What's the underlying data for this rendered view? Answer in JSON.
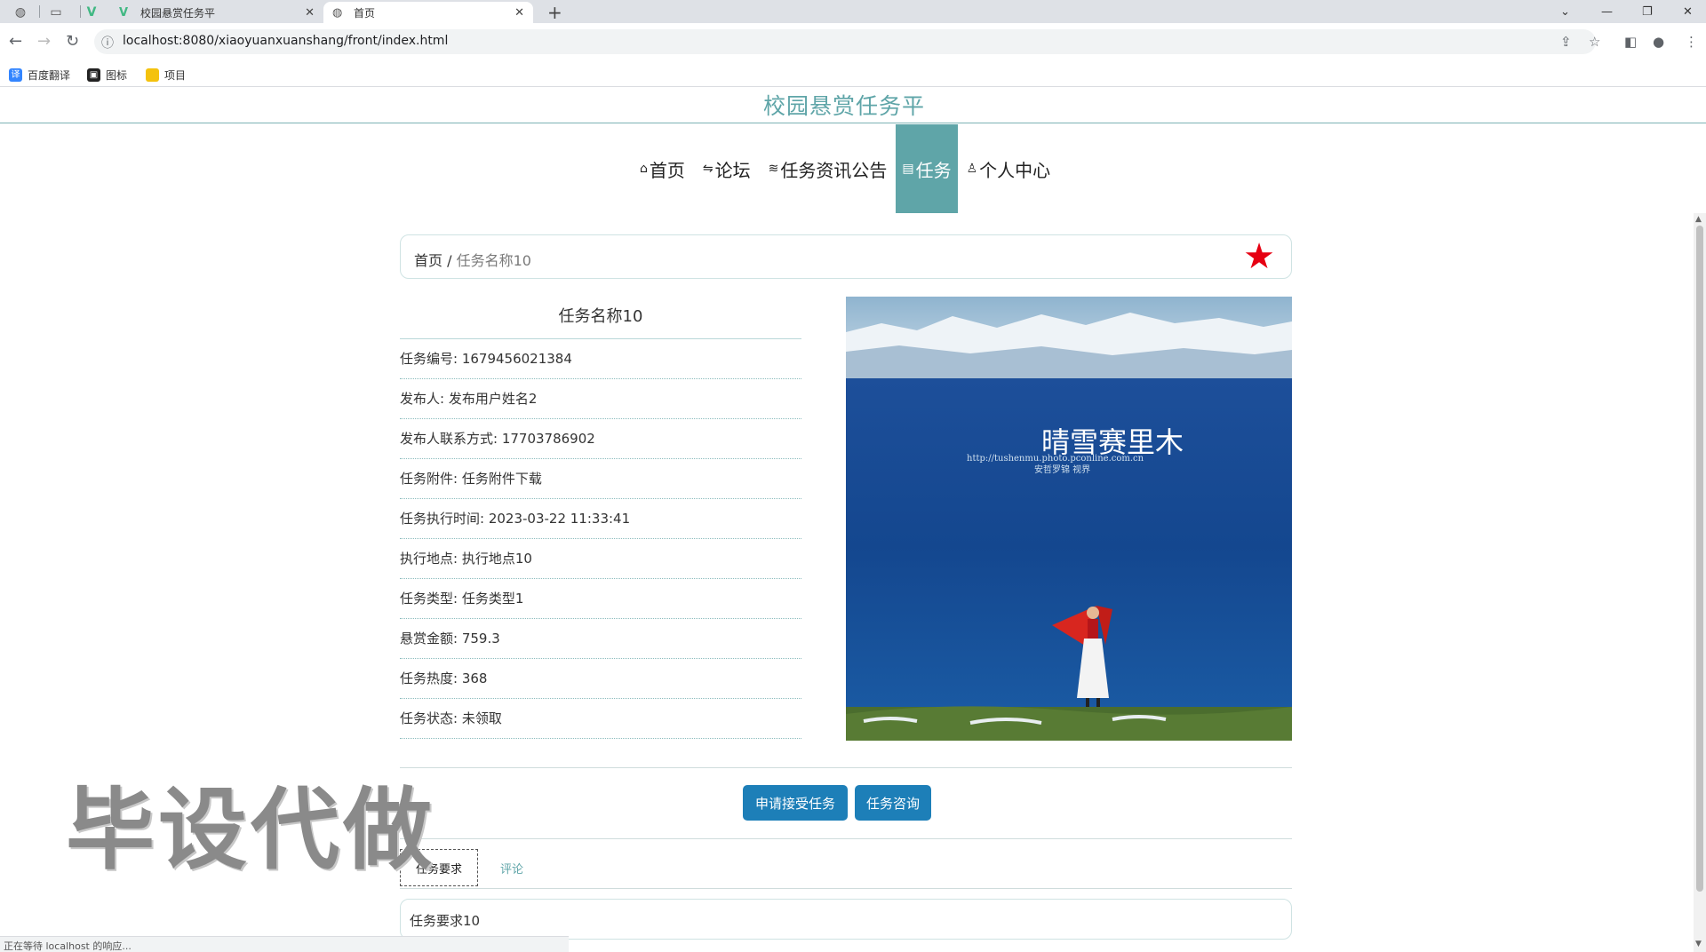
{
  "browser": {
    "tabs": [
      {
        "title": "校园悬赏任务平",
        "close": "✕"
      },
      {
        "title": "首页",
        "close": "✕"
      }
    ],
    "url": "localhost:8080/xiaoyuanxuanshang/front/index.html",
    "bookmarks": [
      "百度翻译",
      "图标",
      "项目"
    ],
    "status": "正在等待 localhost 的响应..."
  },
  "site": {
    "title": "校园悬赏任务平"
  },
  "menu": {
    "items": [
      {
        "label": "首页",
        "icon": "home-icon"
      },
      {
        "label": "论坛",
        "icon": "forum-icon"
      },
      {
        "label": "任务资讯公告",
        "icon": "news-icon"
      },
      {
        "label": "任务",
        "icon": "task-icon"
      },
      {
        "label": "个人中心",
        "icon": "user-icon"
      }
    ],
    "active": "任务"
  },
  "breadcrumb": {
    "home": "首页",
    "sep": "/",
    "current": "任务名称10"
  },
  "favorite_color": "#e60012",
  "detail": {
    "title": "任务名称10",
    "rows": [
      "任务编号: 1679456021384",
      "发布人: 发布用户姓名2",
      "发布人联系方式: 17703786902",
      "任务附件: 任务附件下载",
      "任务执行时间: 2023-03-22 11:33:41",
      "执行地点: 执行地点10",
      "任务类型: 任务类型1",
      "悬赏金额: 759.3",
      "任务热度: 368",
      "任务状态: 未领取"
    ]
  },
  "photo": {
    "caption_main": "晴雪赛里木",
    "caption_url": "http://tushenmu.photo.pconline.com.cn",
    "caption_sub": "安哲罗锦  视界"
  },
  "actions": {
    "apply": "申请接受任务",
    "consult": "任务咨询"
  },
  "tabs": {
    "requirements": "任务要求",
    "comments": "评论"
  },
  "requirements_content": "任务要求10",
  "watermark": "毕设代做",
  "accent_color": "#5fa5a8",
  "button_color": "#1d7fb8"
}
